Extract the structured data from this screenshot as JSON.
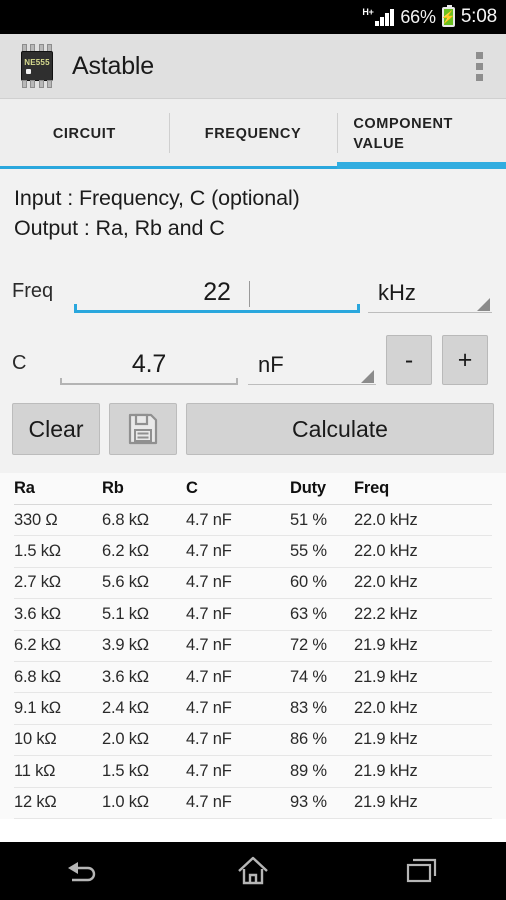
{
  "status_bar": {
    "network_type": "H+",
    "battery_percent": "66%",
    "time": "5:08",
    "signal_icon": "signal-bars-icon",
    "battery_icon": "battery-charging-icon"
  },
  "app_bar": {
    "icon": "ne555-chip-icon",
    "chip_label": "NE555",
    "title": "Astable",
    "overflow_icon": "overflow-menu-icon"
  },
  "tabs": [
    {
      "label": "CIRCUIT",
      "active": false
    },
    {
      "label": "FREQUENCY",
      "active": false
    },
    {
      "label": "COMPONENT VALUE",
      "active": true
    }
  ],
  "description": {
    "input_line": "Input : Frequency, C (optional)",
    "output_line": "Output : Ra, Rb and C"
  },
  "form": {
    "freq": {
      "label": "Freq",
      "value": "22",
      "placeholder": "",
      "unit": "kHz",
      "focused": true
    },
    "cap": {
      "label": "C",
      "value": "4.7",
      "placeholder": "",
      "unit": "nF",
      "focused": false,
      "decrement_label": "-",
      "increment_label": "+"
    }
  },
  "actions": {
    "clear_label": "Clear",
    "save_icon": "floppy-disk-save-icon",
    "calculate_label": "Calculate"
  },
  "results_table": {
    "columns": [
      "Ra",
      "Rb",
      "C",
      "Duty",
      "Freq"
    ],
    "rows": [
      [
        "330 Ω",
        "6.8 kΩ",
        "4.7 nF",
        "51 %",
        "22.0 kHz"
      ],
      [
        "1.5 kΩ",
        "6.2 kΩ",
        "4.7 nF",
        "55 %",
        "22.0 kHz"
      ],
      [
        "2.7 kΩ",
        "5.6 kΩ",
        "4.7 nF",
        "60 %",
        "22.0 kHz"
      ],
      [
        "3.6 kΩ",
        "5.1 kΩ",
        "4.7 nF",
        "63 %",
        "22.2 kHz"
      ],
      [
        "6.2 kΩ",
        "3.9 kΩ",
        "4.7 nF",
        "72 %",
        "21.9 kHz"
      ],
      [
        "6.8 kΩ",
        "3.6 kΩ",
        "4.7 nF",
        "74 %",
        "21.9 kHz"
      ],
      [
        "9.1 kΩ",
        "2.4 kΩ",
        "4.7 nF",
        "83 %",
        "22.0 kHz"
      ],
      [
        "10 kΩ",
        "2.0 kΩ",
        "4.7 nF",
        "86 %",
        "21.9 kHz"
      ],
      [
        "11 kΩ",
        "1.5 kΩ",
        "4.7 nF",
        "89 %",
        "21.9 kHz"
      ],
      [
        "12 kΩ",
        "1.0 kΩ",
        "4.7 nF",
        "93 %",
        "21.9 kHz"
      ]
    ]
  },
  "nav_bar": {
    "back_icon": "back-arrow-icon",
    "home_icon": "home-icon",
    "recents_icon": "recent-apps-icon"
  },
  "colors": {
    "accent": "#2aa7dd",
    "appbar_bg": "#e0e0e0",
    "content_bg": "#f2f2f2",
    "battery_green": "#6abf1f"
  }
}
